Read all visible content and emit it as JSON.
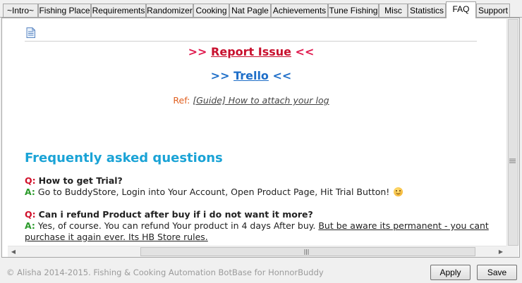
{
  "tabs": [
    {
      "label": "~Intro~"
    },
    {
      "label": "Fishing Place"
    },
    {
      "label": "Requirements"
    },
    {
      "label": "Randomizer"
    },
    {
      "label": "Cooking"
    },
    {
      "label": "Nat Pagle"
    },
    {
      "label": "Achievements"
    },
    {
      "label": "Tune Fishing"
    },
    {
      "label": "Misc"
    },
    {
      "label": "Statistics"
    },
    {
      "label": "FAQ"
    },
    {
      "label": "Support"
    }
  ],
  "active_tab": "FAQ",
  "content": {
    "report": {
      "prefix": ">> ",
      "link": "Report Issue",
      "suffix": " <<"
    },
    "trello": {
      "prefix": ">> ",
      "link": "Trello",
      "suffix": " <<"
    },
    "ref": {
      "label": "Ref: ",
      "link": "[Guide] How to attach your log"
    },
    "faq_title": "Frequently asked questions",
    "qa": [
      {
        "q_mark": "Q:",
        "question": "How to get Trial?",
        "a_mark": "A:",
        "answer": "Go to BuddyStore, Login into Your Account, Open Product Page, Hit Trial Button!"
      },
      {
        "q_mark": "Q:",
        "question": "Can i refund Product after buy if i do not want it more?",
        "a_mark": "A:",
        "answer": "Yes, of course. You can refund Your product in 4 days After buy.",
        "answer_underlined": "But be aware its permanent - you cant purchase it again ever. Its HB Store rules."
      }
    ]
  },
  "status_text": "© Alisha 2014-2015. Fishing  & Cooking Automation BotBase for HonnorBuddy",
  "buttons": {
    "apply": "Apply",
    "save": "Save"
  }
}
